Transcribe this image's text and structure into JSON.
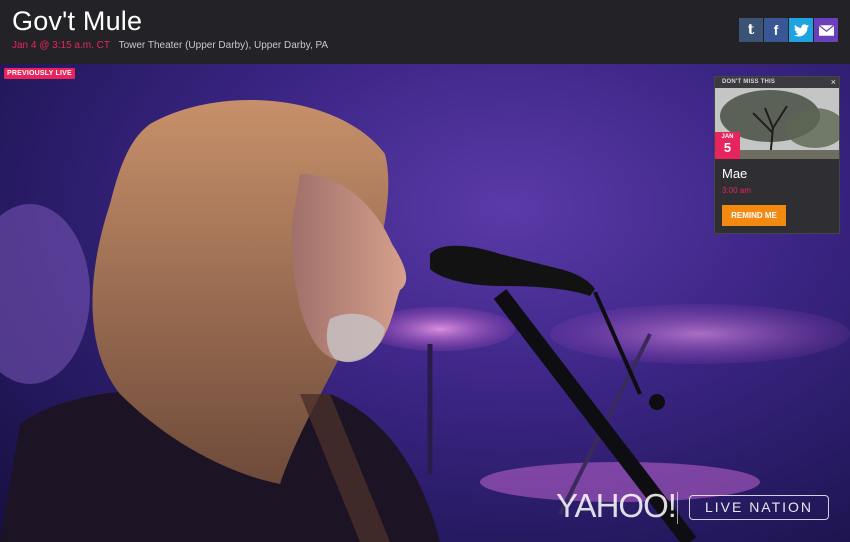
{
  "header": {
    "title": "Gov't Mule",
    "datetime": "Jan 4 @ 3:15 a.m. CT",
    "venue": "Tower Theater (Upper Darby), Upper Darby, PA"
  },
  "share": {
    "tumblr": "t",
    "facebook": "f",
    "twitter": "twitter-icon",
    "email": "email-icon"
  },
  "video": {
    "badge": "PREVIOUSLY LIVE",
    "yahoo_logo": "YAHOO!",
    "livenation_logo": "LIVE NATION"
  },
  "promo": {
    "header": "DON'T MISS THIS",
    "close": "×",
    "month": "JAN",
    "day": "5",
    "name": "Mae",
    "time": "3:00 am",
    "button": "REMIND ME"
  },
  "colors": {
    "accent": "#e8245f",
    "button": "#f28a11",
    "header_bg": "#232327"
  }
}
